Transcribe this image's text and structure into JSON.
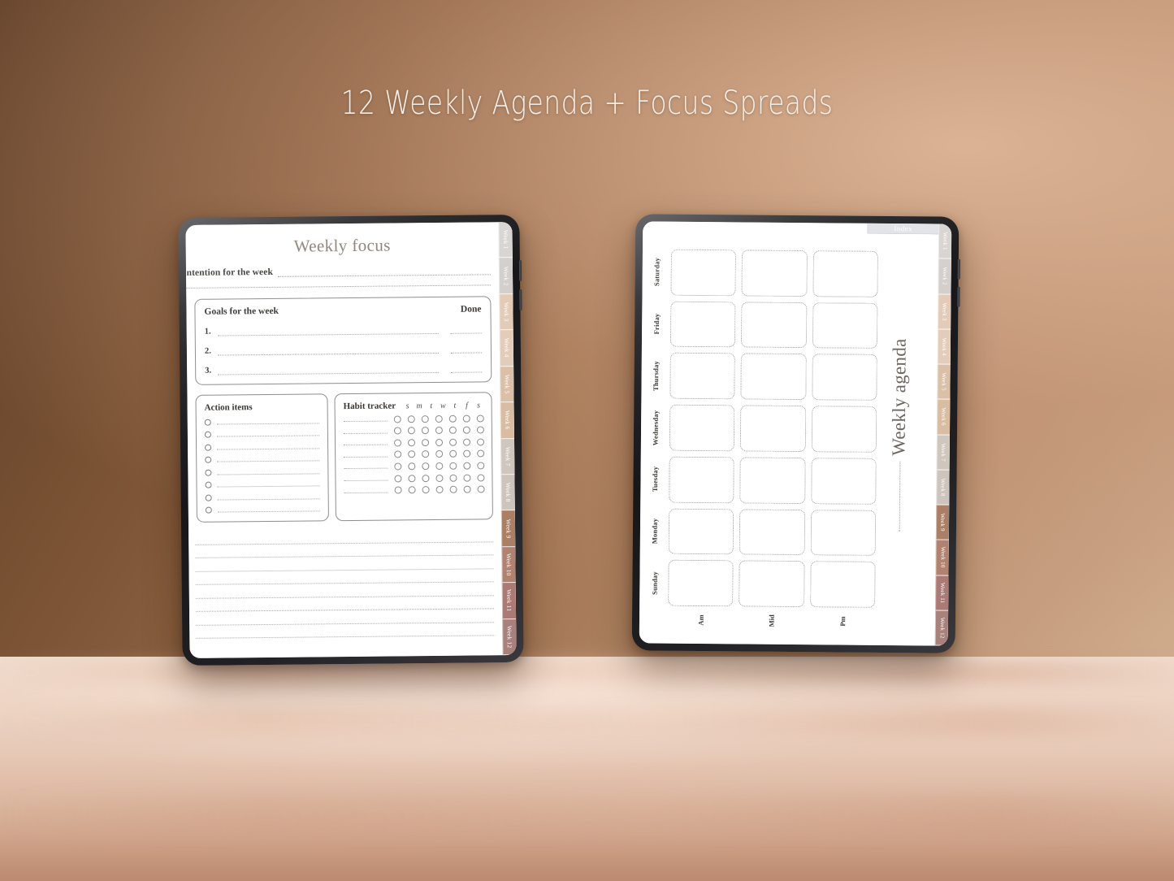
{
  "headline": "12 Weekly Agenda + Focus Spreads",
  "colors": {
    "wall_dark": "#5d3d26",
    "wall_light": "#cfab8c",
    "floor": "#ecd2c1",
    "headline_text": "#f6efe9",
    "page_title_text": "#8b8377",
    "index_tab_bg": "#e2e3e8"
  },
  "week_tabs": [
    {
      "label": "Week 1",
      "color": "#d8d4d2"
    },
    {
      "label": "Week 2",
      "color": "#d3cfcd"
    },
    {
      "label": "Week 3",
      "color": "#e4cbb8"
    },
    {
      "label": "Week 4",
      "color": "#e3cdba"
    },
    {
      "label": "Week 5",
      "color": "#dbc0a8"
    },
    {
      "label": "Week 6",
      "color": "#d9bda3"
    },
    {
      "label": "Week 7",
      "color": "#cfc6be"
    },
    {
      "label": "Week 8",
      "color": "#cdc4bd"
    },
    {
      "label": "Week 9",
      "color": "#ab7f66"
    },
    {
      "label": "Week 10",
      "color": "#b28270"
    },
    {
      "label": "Week 11",
      "color": "#ab7a74"
    },
    {
      "label": "Week 12",
      "color": "#a8807c"
    }
  ],
  "left_page": {
    "title": "Weekly focus",
    "intention_label": "Intention for the week",
    "goals": {
      "heading": "Goals for the week",
      "done_heading": "Done",
      "numbers": [
        "1.",
        "2.",
        "3."
      ]
    },
    "action_items": {
      "heading": "Action items",
      "row_count": 8
    },
    "habit_tracker": {
      "heading": "Habit tracker",
      "day_initials": [
        "s",
        "m",
        "t",
        "w",
        "t",
        "f",
        "s"
      ],
      "row_count": 7,
      "dots_per_row": 7
    },
    "notes_line_count": 8
  },
  "right_page": {
    "index_label": "Index",
    "title": "Weekly agenda",
    "days": [
      "Saturday",
      "Friday",
      "Thursday",
      "Wednesday",
      "Tuesday",
      "Monday",
      "Sunday"
    ],
    "time_slots": [
      "Am",
      "Mid",
      "Pm"
    ]
  }
}
